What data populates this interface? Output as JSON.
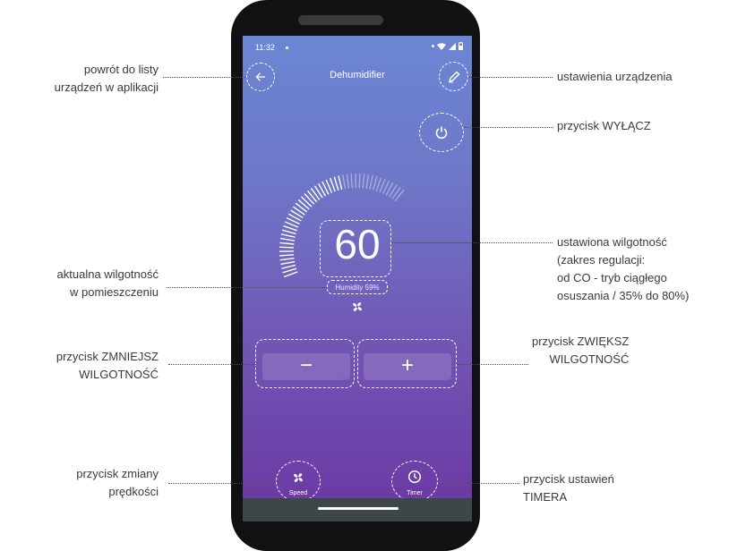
{
  "status_bar": {
    "time": "11:32"
  },
  "app": {
    "title": "Dehumidifier"
  },
  "humidity": {
    "set_value": "60",
    "current_label": "Humidity 59%"
  },
  "controls": {
    "minus": "−",
    "plus": "+"
  },
  "bottom": {
    "speed_label": "Speed",
    "timer_label": "Timer"
  },
  "annotations": {
    "back": [
      "powrót do listy",
      "urządzeń w aplikacji"
    ],
    "settings": "ustawienia urządzenia",
    "power": "przycisk WYŁĄCZ",
    "set_humidity": [
      "ustawiona wilgotność",
      "(zakres regulacji:",
      "od CO - tryb ciągłego",
      "osuszania / 35% do 80%)"
    ],
    "current_humidity": [
      "aktualna wilgotność",
      "w pomieszczeniu"
    ],
    "decrease": [
      "przycisk ZMNIEJSZ",
      "WILGOTNOŚĆ"
    ],
    "increase": [
      "przycisk ZWIĘKSZ",
      "WILGOTNOŚĆ"
    ],
    "speed": [
      "przycisk zmiany",
      "prędkości"
    ],
    "timer": [
      "przycisk ustawień",
      "TIMERA"
    ]
  },
  "icons": {
    "back": "arrow-left-icon",
    "edit": "pencil-icon",
    "power": "power-icon",
    "fan": "fan-icon",
    "timer": "clock-icon"
  },
  "colors": {
    "gradient_top": "#6b86d3",
    "gradient_bottom": "#6b37a2",
    "nav_bar": "#3d4747",
    "text_annotation": "#3a3a3a"
  }
}
